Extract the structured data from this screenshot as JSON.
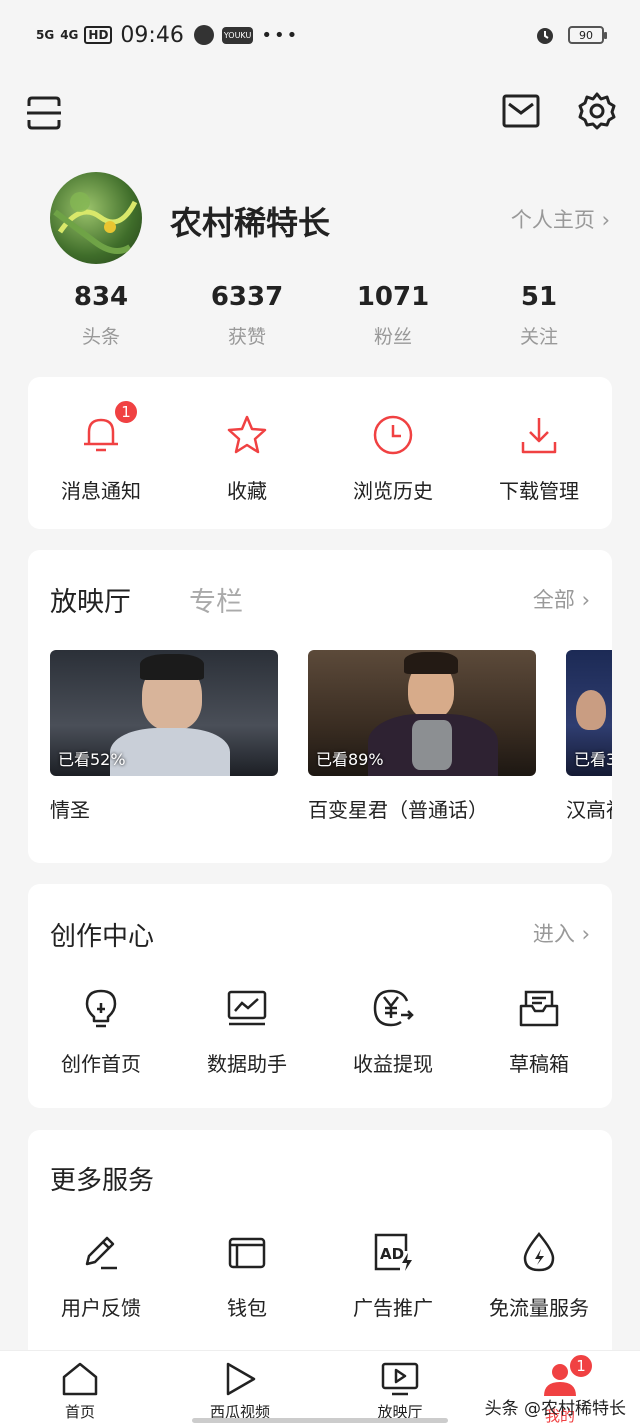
{
  "status_bar": {
    "signal1": "5G",
    "signal2": "4G",
    "hd": "HD",
    "time": "09:46",
    "youku": "YOUKU",
    "dots": "•••",
    "battery": "90"
  },
  "profile": {
    "username": "农村稀特长",
    "homepage_link": "个人主页 ›"
  },
  "stats": [
    {
      "value": "834",
      "label": "头条"
    },
    {
      "value": "6337",
      "label": "获赞"
    },
    {
      "value": "1071",
      "label": "粉丝"
    },
    {
      "value": "51",
      "label": "关注"
    }
  ],
  "quick_actions": [
    {
      "label": "消息通知",
      "icon": "bell-icon",
      "badge": "1"
    },
    {
      "label": "收藏",
      "icon": "star-icon"
    },
    {
      "label": "浏览历史",
      "icon": "clock-icon"
    },
    {
      "label": "下载管理",
      "icon": "download-icon"
    }
  ],
  "theater": {
    "tab_active": "放映厅",
    "tab_inactive": "专栏",
    "more": "全部 ›",
    "videos": [
      {
        "title": "情圣",
        "progress": "已看52%"
      },
      {
        "title": "百变星君（普通话）",
        "progress": "已看89%"
      },
      {
        "title": "汉高祖",
        "progress": "已看3"
      }
    ]
  },
  "creator": {
    "title": "创作中心",
    "more": "进入 ›",
    "items": [
      {
        "label": "创作首页",
        "icon": "lightbulb-icon"
      },
      {
        "label": "数据助手",
        "icon": "chart-monitor-icon"
      },
      {
        "label": "收益提现",
        "icon": "yuan-withdraw-icon"
      },
      {
        "label": "草稿箱",
        "icon": "drafts-icon"
      }
    ]
  },
  "services": {
    "title": "更多服务",
    "items": [
      {
        "label": "用户反馈",
        "icon": "pen-icon"
      },
      {
        "label": "钱包",
        "icon": "wallet-icon"
      },
      {
        "label": "广告推广",
        "icon": "ad-icon"
      },
      {
        "label": "免流量服务",
        "icon": "drop-icon"
      }
    ]
  },
  "tabbar": [
    {
      "label": "首页",
      "icon": "home-icon"
    },
    {
      "label": "西瓜视频",
      "icon": "play-icon"
    },
    {
      "label": "放映厅",
      "icon": "tv-play-icon"
    },
    {
      "label": "我的",
      "icon": "user-icon",
      "badge": "1"
    }
  ],
  "watermark": "头条 @农村稀特长",
  "colors": {
    "accent": "#f04142",
    "text": "#222222",
    "muted": "#999999",
    "bg": "#f5f5f5"
  }
}
